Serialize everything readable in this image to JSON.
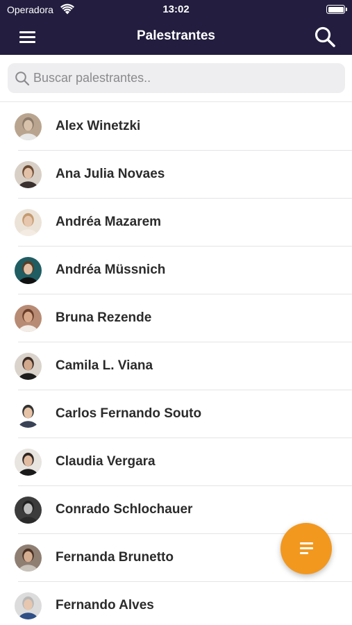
{
  "status_bar": {
    "carrier": "Operadora",
    "time": "13:02"
  },
  "navbar": {
    "title": "Palestrantes",
    "menu_icon": "hamburger-menu-icon",
    "search_icon": "search-icon",
    "background": "#231d3f"
  },
  "search": {
    "placeholder": "Buscar palestrantes.."
  },
  "speakers": [
    {
      "name": "Alex Winetzki",
      "bg": "#b9a58f",
      "skin": "#d9c2ab",
      "hair": "#8c7b6a",
      "shirt": "#e8e8e8"
    },
    {
      "name": "Ana Julia Novaes",
      "bg": "#d8cfc6",
      "skin": "#e3c1a8",
      "hair": "#6b4a32",
      "shirt": "#3a3030"
    },
    {
      "name": "Andréa Mazarem",
      "bg": "#ece3d8",
      "skin": "#e7c7ae",
      "hair": "#c49a70",
      "shirt": "#f4ece2"
    },
    {
      "name": "Andréa Müssnich",
      "bg": "#1f5d63",
      "skin": "#e2bfa4",
      "hair": "#5a3d25",
      "shirt": "#111111"
    },
    {
      "name": "Bruna Rezende",
      "bg": "#b88b74",
      "skin": "#d8a98b",
      "hair": "#6a3e2a",
      "shirt": "#f3ece6"
    },
    {
      "name": "Camila L. Viana",
      "bg": "#d9d3cc",
      "skin": "#d2a98c",
      "hair": "#3a2a22",
      "shirt": "#1d1d1d"
    },
    {
      "name": "Carlos Fernando Souto",
      "bg": "#ffffff",
      "skin": "#e6c2a6",
      "hair": "#333333",
      "shirt": "#3a4356"
    },
    {
      "name": "Claudia Vergara",
      "bg": "#e8e4e0",
      "skin": "#e2bca1",
      "hair": "#2f2521",
      "shirt": "#1a1a1a"
    },
    {
      "name": "Conrado Schlochauer",
      "bg": "#3c3c3c",
      "skin": "#bdbdbd",
      "hair": "#222222",
      "shirt": "#2a2a2a"
    },
    {
      "name": "Fernanda Brunetto",
      "bg": "#8f7f73",
      "skin": "#d5ae92",
      "hair": "#4a3124",
      "shirt": "#c9c2bb"
    },
    {
      "name": "Fernando Alves",
      "bg": "#dcdcdc",
      "skin": "#e7c7b0",
      "hair": "#b8b8b8",
      "shirt": "#2f4f86"
    }
  ],
  "fab": {
    "icon": "filter-lines-icon",
    "color": "#f2981f"
  }
}
